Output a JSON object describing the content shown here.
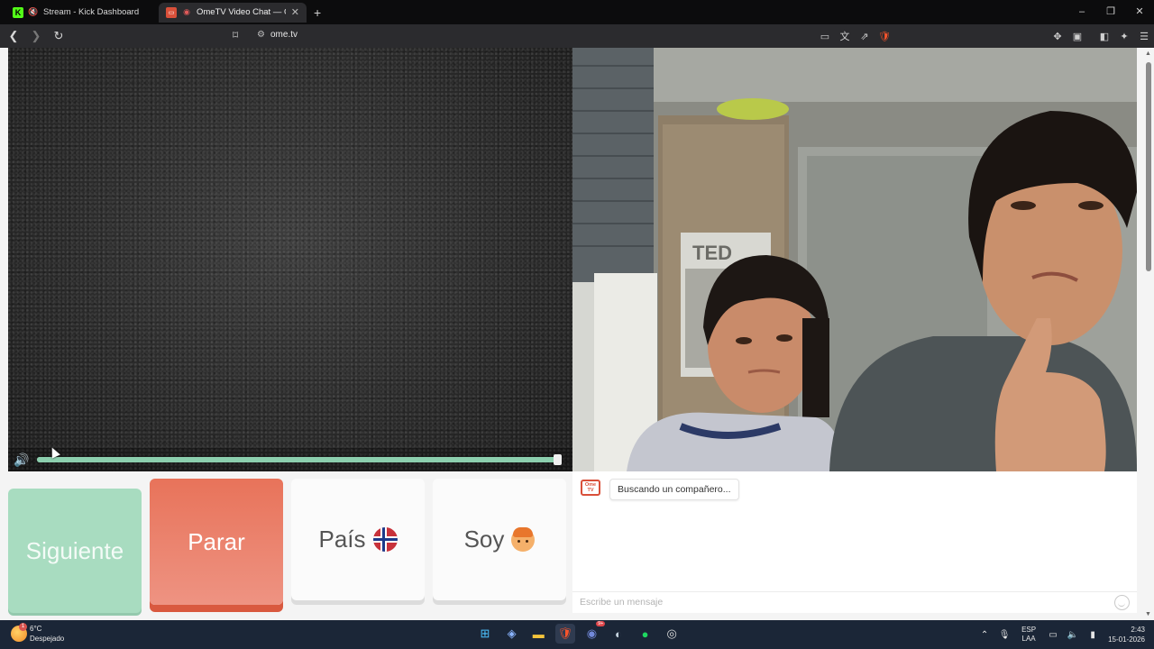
{
  "browser": {
    "tabs": [
      {
        "title": "Stream - Kick Dashboard",
        "active": false,
        "has_close": false
      },
      {
        "title": "OmeTV Video Chat — Omeg",
        "active": true,
        "has_close": true
      }
    ],
    "new_tab": "+",
    "window_controls": {
      "minimize": "–",
      "maximize": "❐",
      "close": "✕"
    },
    "url": "ome.tv"
  },
  "local_video": {
    "volume_level": 1.0
  },
  "buttons": {
    "next": "Siguiente",
    "stop": "Parar",
    "country": "País",
    "gender": "Soy"
  },
  "chat": {
    "logo_text_top": "Ome",
    "logo_text_bottom": "TV",
    "status": "Buscando un compañero...",
    "placeholder": "Escribe un mensaje"
  },
  "taskbar": {
    "weather_temp": "6°C",
    "weather_desc": "Despejado",
    "weather_badge": "1",
    "lang_top": "ESP",
    "lang_bottom": "LAA",
    "time": "2:43",
    "date": "15-01-2026",
    "discord_badge": "9+"
  },
  "colors": {
    "next": "#a8dcc0",
    "stop": "#e8735a",
    "accent_logo": "#d9503a",
    "taskbar": "#1b2637"
  }
}
